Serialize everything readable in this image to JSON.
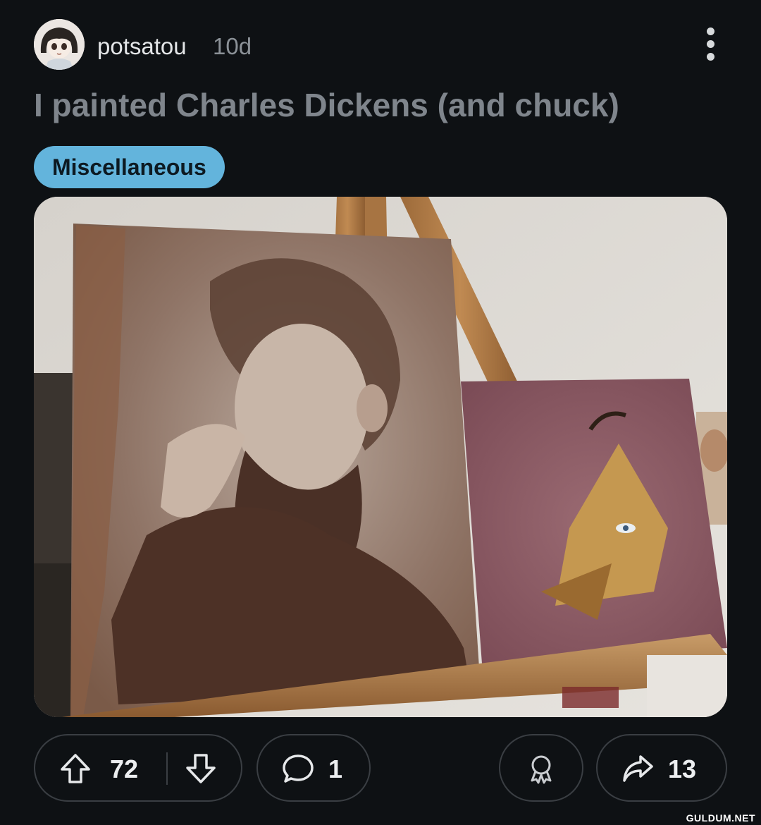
{
  "post": {
    "username": "potsatou",
    "age": "10d",
    "title": "I painted Charles Dickens (and chuck)",
    "flair": "Miscellaneous"
  },
  "actions": {
    "upvotes": "72",
    "comments": "1",
    "shares": "13"
  },
  "icons": {
    "avatar": "avatar",
    "more": "more-options-icon",
    "upvote": "upvote-arrow-icon",
    "downvote": "downvote-arrow-icon",
    "comment": "comment-bubble-icon",
    "award": "award-ribbon-icon",
    "share": "share-arrow-icon"
  },
  "colors": {
    "background": "#0e1114",
    "flair": "#63b4dc",
    "title": "#7f858c"
  },
  "watermark": "GULDUM.NET"
}
